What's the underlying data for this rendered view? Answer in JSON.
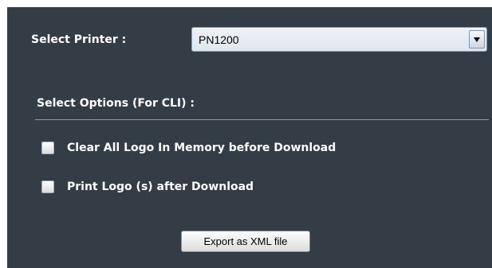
{
  "printer": {
    "label": "Select Printer :",
    "selected_value": "PN1200"
  },
  "options": {
    "heading": "Select Options (For CLI) :",
    "items": [
      {
        "label": "Clear All Logo In Memory before Download",
        "checked": false
      },
      {
        "label": "Print Logo (s) after Download",
        "checked": false
      }
    ]
  },
  "export_button": {
    "label": "Export as XML file"
  },
  "colors": {
    "panel_background": "#343d46",
    "text": "#ffffff",
    "select_border": "#8a9fb8"
  },
  "icons": {
    "dropdown": "chevron-down-icon"
  }
}
